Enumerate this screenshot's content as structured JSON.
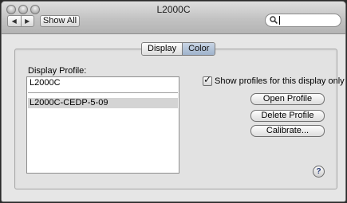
{
  "window": {
    "title": "L2000C"
  },
  "toolbar": {
    "back_icon": "left-arrow-icon",
    "forward_icon": "right-arrow-icon",
    "show_all_label": "Show All",
    "search": {
      "value": "",
      "icon": "search-icon"
    }
  },
  "tabs": [
    {
      "label": "Display",
      "selected": false
    },
    {
      "label": "Color",
      "selected": true
    }
  ],
  "color_pane": {
    "display_profile_label": "Display Profile:",
    "profiles": [
      {
        "name": "L2000C",
        "selected": false
      },
      {
        "name": "L2000C-CEDP-5-09",
        "selected": true
      }
    ],
    "show_profiles_checkbox": {
      "label": "Show profiles for this display only",
      "checked": true,
      "mark": "✓"
    },
    "buttons": {
      "open_profile": "Open Profile",
      "delete_profile": "Delete Profile",
      "calibrate": "Calibrate..."
    },
    "help_glyph": "?"
  },
  "colors": {
    "selected_tab": "#a9bcd4",
    "selected_row": "#d4d4d4",
    "help_glyph": "#2a3e7a"
  }
}
